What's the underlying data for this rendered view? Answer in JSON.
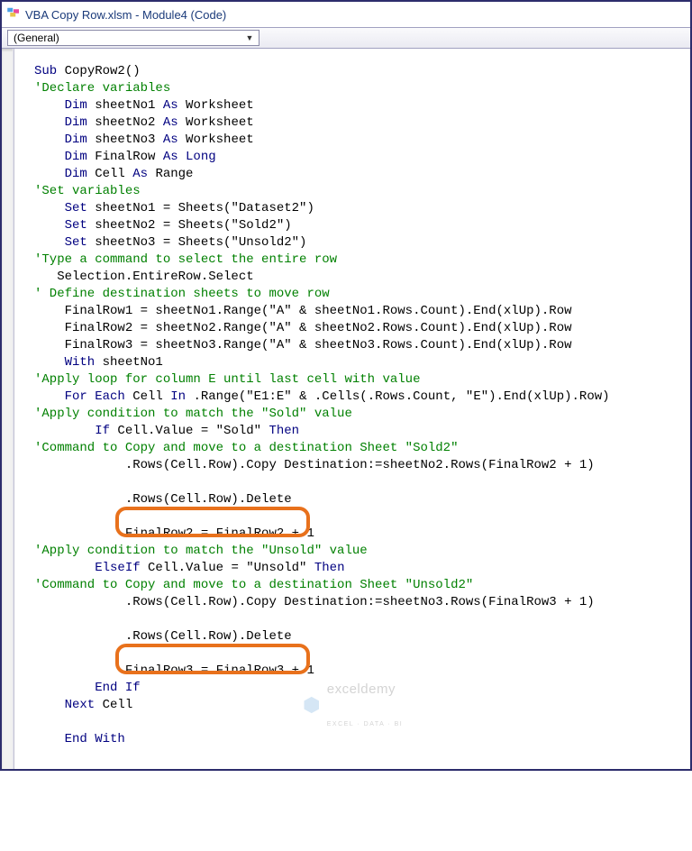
{
  "window": {
    "title": "VBA Copy Row.xlsm - Module4 (Code)"
  },
  "dropdown": {
    "value": "(General)"
  },
  "code": {
    "l01a": "Sub",
    "l01b": " CopyRow2()",
    "l02": "'Declare variables",
    "l03a": "    Dim",
    "l03b": " sheetNo1 ",
    "l03c": "As",
    "l03d": " Worksheet",
    "l04a": "    Dim",
    "l04b": " sheetNo2 ",
    "l04c": "As",
    "l04d": " Worksheet",
    "l05a": "    Dim",
    "l05b": " sheetNo3 ",
    "l05c": "As",
    "l05d": " Worksheet",
    "l06a": "    Dim",
    "l06b": " FinalRow ",
    "l06c": "As Long",
    "l07a": "    Dim",
    "l07b": " Cell ",
    "l07c": "As",
    "l07d": " Range",
    "l08": "'Set variables",
    "l09a": "    Set",
    "l09b": " sheetNo1 = Sheets(\"Dataset2\")",
    "l10a": "    Set",
    "l10b": " sheetNo2 = Sheets(\"Sold2\")",
    "l11a": "    Set",
    "l11b": " sheetNo3 = Sheets(\"Unsold2\")",
    "l12": "'Type a command to select the entire row",
    "l13": "   Selection.EntireRow.Select",
    "l14": "' Define destination sheets to move row",
    "l15": "    FinalRow1 = sheetNo1.Range(\"A\" & sheetNo1.Rows.Count).End(xlUp).Row",
    "l16": "    FinalRow2 = sheetNo2.Range(\"A\" & sheetNo2.Rows.Count).End(xlUp).Row",
    "l17": "    FinalRow3 = sheetNo3.Range(\"A\" & sheetNo3.Rows.Count).End(xlUp).Row",
    "l18a": "    With",
    "l18b": " sheetNo1",
    "l19": "'Apply loop for column E until last cell with value",
    "l20a": "    For Each",
    "l20b": " Cell ",
    "l20c": "In",
    "l20d": " .Range(\"E1:E\" & .Cells(.Rows.Count, \"E\").End(xlUp).Row)",
    "l21": "'Apply condition to match the \"Sold\" value",
    "l22a": "        If",
    "l22b": " Cell.Value = \"Sold\" ",
    "l22c": "Then",
    "l23": "'Command to Copy and move to a destination Sheet \"Sold2\"",
    "l24": "            .Rows(Cell.Row).Copy Destination:=sheetNo2.Rows(FinalRow2 + 1)",
    "l25": "            .Rows(Cell.Row).Delete",
    "l26": "            FinalRow2 = FinalRow2 + 1",
    "l27": "'Apply condition to match the \"Unsold\" value",
    "l28a": "        ElseIf",
    "l28b": " Cell.Value = \"Unsold\" ",
    "l28c": "Then",
    "l29": "'Command to Copy and move to a destination Sheet \"Unsold2\"",
    "l30": "            .Rows(Cell.Row).Copy Destination:=sheetNo3.Rows(FinalRow3 + 1)",
    "l31": "            .Rows(Cell.Row).Delete",
    "l32": "            FinalRow3 = FinalRow3 + 1",
    "l33": "        End If",
    "l34a": "    Next",
    "l34b": " Cell",
    "l35": "    End With"
  },
  "watermark": {
    "brand": "exceldemy",
    "tagline": "EXCEL · DATA · BI"
  }
}
